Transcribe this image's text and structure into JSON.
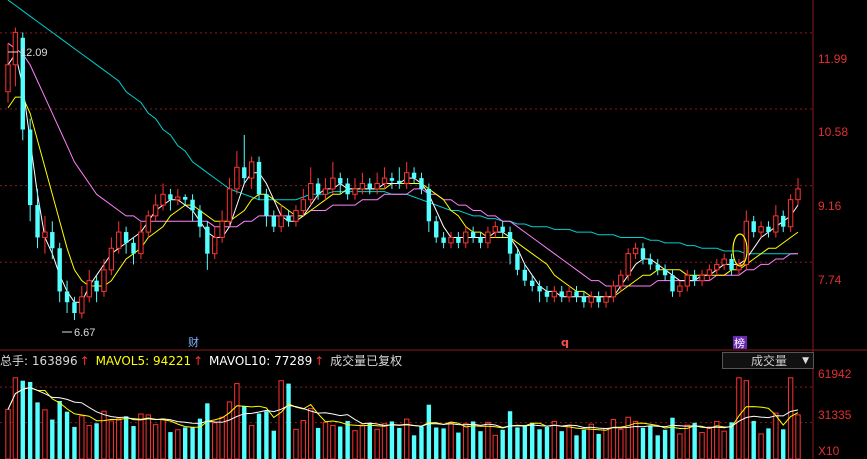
{
  "price_axis": {
    "ticks": [
      "11.99",
      "10.58",
      "9.16",
      "7.74"
    ]
  },
  "volume_axis": {
    "ticks": [
      "61942",
      "31335"
    ],
    "unit_label": "X10"
  },
  "annotations": {
    "high": "12.09",
    "low": "6.67",
    "event_a": "财",
    "event_b": "q",
    "event_c": "榜"
  },
  "volume_info": {
    "total_label": "总手: 163896",
    "ma5_label": "MAVOL5: 94221",
    "ma10_label": "MAVOL10: 77289",
    "arrow": "↑",
    "note": "成交量已复权"
  },
  "indicator_select": {
    "value": "成交量"
  },
  "colors": {
    "up": "#ff3232",
    "down": "#54ffff",
    "ma_white": "#ffffff",
    "ma_yellow": "#ffff00",
    "ma_magenta": "#ff80ff",
    "ma_cyan": "#00d0d0",
    "grid": "#8a1a1a"
  },
  "chart_data": {
    "type": "candlestick",
    "price_range": [
      6.3,
      12.6
    ],
    "price_ticks": [
      11.99,
      10.58,
      9.16,
      7.74
    ],
    "high_marker": 12.09,
    "low_marker": 6.67,
    "candles": [
      [
        10.9,
        11.4,
        11.8,
        10.7
      ],
      [
        11.4,
        12.0,
        12.09,
        11.0
      ],
      [
        11.9,
        10.2,
        12.0,
        10.0
      ],
      [
        10.2,
        8.8,
        10.4,
        8.5
      ],
      [
        8.8,
        8.2,
        9.1,
        8.0
      ],
      [
        8.2,
        8.3,
        8.6,
        7.9
      ],
      [
        8.3,
        8.0,
        8.5,
        7.8
      ],
      [
        8.0,
        7.2,
        8.1,
        7.0
      ],
      [
        7.2,
        7.0,
        7.4,
        6.8
      ],
      [
        7.0,
        6.8,
        7.1,
        6.67
      ],
      [
        6.8,
        7.1,
        7.3,
        6.7
      ],
      [
        7.1,
        7.4,
        7.6,
        7.0
      ],
      [
        7.4,
        7.2,
        7.5,
        7.0
      ],
      [
        7.2,
        7.6,
        7.8,
        7.1
      ],
      [
        7.6,
        8.0,
        8.2,
        7.5
      ],
      [
        8.0,
        8.3,
        8.5,
        7.9
      ],
      [
        8.3,
        8.1,
        8.4,
        7.9
      ],
      [
        8.1,
        7.9,
        8.2,
        7.7
      ],
      [
        7.9,
        8.3,
        8.5,
        7.8
      ],
      [
        8.3,
        8.6,
        8.7,
        8.2
      ],
      [
        8.6,
        8.8,
        9.0,
        8.5
      ],
      [
        8.8,
        9.0,
        9.2,
        8.7
      ],
      [
        9.0,
        8.9,
        9.1,
        8.7
      ],
      [
        8.9,
        8.95,
        9.1,
        8.8
      ],
      [
        8.95,
        8.9,
        9.0,
        8.8
      ],
      [
        8.9,
        8.7,
        9.0,
        8.5
      ],
      [
        8.7,
        8.4,
        8.8,
        8.2
      ],
      [
        8.4,
        7.9,
        8.5,
        7.6
      ],
      [
        7.9,
        8.2,
        8.4,
        7.8
      ],
      [
        8.2,
        8.5,
        8.7,
        8.1
      ],
      [
        8.5,
        9.1,
        9.3,
        8.4
      ],
      [
        9.1,
        9.5,
        9.8,
        9.0
      ],
      [
        9.5,
        9.3,
        10.1,
        9.2
      ],
      [
        9.3,
        9.6,
        9.7,
        9.1
      ],
      [
        9.6,
        9.0,
        9.7,
        8.9
      ],
      [
        9.0,
        8.6,
        9.1,
        8.4
      ],
      [
        8.6,
        8.4,
        8.7,
        8.3
      ],
      [
        8.4,
        8.6,
        8.8,
        8.3
      ],
      [
        8.6,
        8.5,
        8.7,
        8.4
      ],
      [
        8.5,
        8.7,
        8.8,
        8.4
      ],
      [
        8.7,
        8.9,
        9.1,
        8.6
      ],
      [
        8.9,
        9.2,
        9.5,
        8.8
      ],
      [
        9.2,
        9.0,
        9.3,
        8.9
      ],
      [
        9.0,
        9.1,
        9.3,
        8.9
      ],
      [
        9.1,
        9.3,
        9.6,
        9.0
      ],
      [
        9.3,
        9.2,
        9.4,
        9.0
      ],
      [
        9.2,
        9.0,
        9.3,
        8.9
      ],
      [
        9.0,
        9.1,
        9.3,
        8.9
      ],
      [
        9.1,
        9.2,
        9.4,
        9.0
      ],
      [
        9.2,
        9.1,
        9.3,
        9.0
      ],
      [
        9.1,
        9.2,
        9.4,
        9.0
      ],
      [
        9.2,
        9.3,
        9.5,
        9.1
      ],
      [
        9.3,
        9.25,
        9.4,
        9.1
      ],
      [
        9.25,
        9.2,
        9.5,
        9.1
      ],
      [
        9.2,
        9.4,
        9.6,
        9.1
      ],
      [
        9.4,
        9.3,
        9.5,
        9.2
      ],
      [
        9.3,
        9.1,
        9.4,
        9.0
      ],
      [
        9.1,
        8.5,
        9.2,
        8.3
      ],
      [
        8.5,
        8.2,
        8.6,
        8.1
      ],
      [
        8.2,
        8.1,
        8.3,
        8.0
      ],
      [
        8.1,
        8.2,
        8.3,
        8.0
      ],
      [
        8.2,
        8.1,
        8.3,
        8.0
      ],
      [
        8.1,
        8.3,
        8.4,
        8.0
      ],
      [
        8.3,
        8.2,
        8.4,
        8.1
      ],
      [
        8.2,
        8.1,
        8.3,
        8.0
      ],
      [
        8.1,
        8.3,
        8.4,
        8.0
      ],
      [
        8.3,
        8.4,
        8.5,
        8.2
      ],
      [
        8.4,
        8.3,
        8.5,
        8.2
      ],
      [
        8.3,
        7.9,
        8.4,
        7.7
      ],
      [
        7.9,
        7.6,
        8.0,
        7.5
      ],
      [
        7.6,
        7.4,
        7.7,
        7.3
      ],
      [
        7.4,
        7.3,
        7.5,
        7.2
      ],
      [
        7.3,
        7.2,
        7.4,
        7.0
      ],
      [
        7.2,
        7.1,
        7.3,
        7.0
      ],
      [
        7.1,
        7.2,
        7.3,
        7.0
      ],
      [
        7.2,
        7.1,
        7.3,
        7.0
      ],
      [
        7.1,
        7.2,
        7.3,
        7.0
      ],
      [
        7.2,
        7.1,
        7.3,
        7.0
      ],
      [
        7.1,
        7.0,
        7.2,
        6.9
      ],
      [
        7.0,
        7.1,
        7.2,
        6.9
      ],
      [
        7.1,
        7.0,
        7.2,
        6.9
      ],
      [
        7.0,
        7.1,
        7.2,
        6.9
      ],
      [
        7.1,
        7.3,
        7.4,
        7.0
      ],
      [
        7.3,
        7.5,
        7.6,
        7.2
      ],
      [
        7.5,
        7.9,
        8.0,
        7.4
      ],
      [
        7.9,
        8.0,
        8.1,
        7.8
      ],
      [
        8.0,
        7.8,
        8.1,
        7.7
      ],
      [
        7.8,
        7.7,
        7.9,
        7.6
      ],
      [
        7.7,
        7.6,
        7.8,
        7.5
      ],
      [
        7.6,
        7.5,
        7.7,
        7.4
      ],
      [
        7.5,
        7.2,
        7.6,
        7.1
      ],
      [
        7.2,
        7.3,
        7.4,
        7.1
      ],
      [
        7.3,
        7.5,
        7.6,
        7.2
      ],
      [
        7.5,
        7.4,
        7.6,
        7.3
      ],
      [
        7.4,
        7.5,
        7.6,
        7.3
      ],
      [
        7.5,
        7.6,
        7.7,
        7.4
      ],
      [
        7.6,
        7.7,
        7.8,
        7.5
      ],
      [
        7.7,
        7.8,
        7.9,
        7.6
      ],
      [
        7.8,
        7.6,
        7.9,
        7.5
      ],
      [
        7.6,
        7.7,
        7.8,
        7.5
      ],
      [
        7.7,
        8.5,
        8.7,
        7.6
      ],
      [
        8.5,
        8.3,
        8.6,
        8.2
      ],
      [
        8.3,
        8.4,
        8.5,
        8.2
      ],
      [
        8.4,
        8.3,
        8.5,
        8.2
      ],
      [
        8.3,
        8.6,
        8.8,
        8.2
      ],
      [
        8.6,
        8.4,
        8.7,
        8.3
      ],
      [
        8.4,
        8.9,
        9.0,
        8.3
      ],
      [
        8.9,
        9.1,
        9.3,
        8.8
      ]
    ],
    "ma_white": [
      11.4,
      11.6,
      11.0,
      10.0,
      9.0,
      8.2,
      7.9,
      7.5,
      7.2,
      7.0,
      7.0,
      7.3,
      7.5,
      7.7,
      7.9,
      8.0,
      8.1,
      8.2,
      8.3,
      8.5,
      8.7,
      8.8,
      8.9,
      8.9,
      8.8,
      8.7,
      8.5,
      8.3,
      8.2,
      8.2,
      8.4,
      8.8,
      9.2,
      9.4,
      9.4,
      9.2,
      8.9,
      8.6,
      8.5,
      8.5,
      8.6,
      8.8,
      9.0,
      9.1,
      9.1,
      9.2,
      9.1,
      9.1,
      9.1,
      9.1,
      9.1,
      9.2,
      9.2,
      9.2,
      9.3,
      9.3,
      9.2,
      9.0,
      8.7,
      8.4,
      8.2,
      8.2,
      8.2,
      8.2,
      8.2,
      8.2,
      8.3,
      8.3,
      8.2,
      8.0,
      7.7,
      7.5,
      7.3,
      7.2,
      7.2,
      7.1,
      7.1,
      7.1,
      7.1,
      7.1,
      7.1,
      7.1,
      7.1,
      7.3,
      7.5,
      7.7,
      7.8,
      7.8,
      7.7,
      7.6,
      7.5,
      7.4,
      7.4,
      7.4,
      7.5,
      7.5,
      7.6,
      7.7,
      7.7,
      7.7,
      7.8,
      8.0,
      8.2,
      8.3,
      8.4,
      8.5,
      8.6,
      8.8
    ],
    "ma_yellow": [
      10.6,
      10.8,
      10.8,
      10.5,
      10.0,
      9.5,
      9.0,
      8.5,
      8.0,
      7.6,
      7.4,
      7.3,
      7.3,
      7.3,
      7.4,
      7.6,
      7.8,
      7.9,
      8.0,
      8.2,
      8.3,
      8.4,
      8.6,
      8.7,
      8.8,
      8.8,
      8.7,
      8.6,
      8.5,
      8.5,
      8.5,
      8.6,
      8.7,
      8.9,
      9.0,
      9.0,
      8.9,
      8.8,
      8.7,
      8.6,
      8.6,
      8.7,
      8.8,
      8.9,
      9.0,
      9.0,
      9.1,
      9.1,
      9.1,
      9.1,
      9.1,
      9.1,
      9.2,
      9.2,
      9.2,
      9.2,
      9.2,
      9.1,
      9.0,
      8.9,
      8.7,
      8.6,
      8.4,
      8.3,
      8.3,
      8.2,
      8.2,
      8.2,
      8.2,
      8.1,
      8.0,
      7.9,
      7.8,
      7.7,
      7.5,
      7.4,
      7.3,
      7.2,
      7.2,
      7.1,
      7.1,
      7.1,
      7.1,
      7.2,
      7.3,
      7.4,
      7.5,
      7.5,
      7.6,
      7.6,
      7.6,
      7.6,
      7.5,
      7.5,
      7.5,
      7.5,
      7.5,
      7.5,
      7.6,
      7.6,
      7.7,
      7.8,
      7.9,
      8.0,
      8.0,
      8.1,
      8.2,
      8.3
    ],
    "ma_magenta": [
      11.8,
      11.7,
      11.6,
      11.4,
      11.1,
      10.8,
      10.5,
      10.2,
      9.9,
      9.6,
      9.4,
      9.2,
      9.0,
      8.9,
      8.8,
      8.7,
      8.6,
      8.6,
      8.5,
      8.5,
      8.5,
      8.5,
      8.5,
      8.5,
      8.5,
      8.5,
      8.5,
      8.5,
      8.4,
      8.4,
      8.4,
      8.4,
      8.5,
      8.5,
      8.6,
      8.6,
      8.6,
      8.6,
      8.6,
      8.6,
      8.6,
      8.7,
      8.7,
      8.7,
      8.8,
      8.8,
      8.8,
      8.8,
      8.9,
      8.9,
      8.9,
      9.0,
      9.0,
      9.0,
      9.0,
      9.1,
      9.1,
      9.0,
      9.0,
      8.9,
      8.9,
      8.8,
      8.8,
      8.7,
      8.7,
      8.6,
      8.6,
      8.5,
      8.5,
      8.4,
      8.3,
      8.2,
      8.1,
      8.0,
      7.9,
      7.8,
      7.7,
      7.6,
      7.5,
      7.4,
      7.4,
      7.3,
      7.3,
      7.3,
      7.3,
      7.3,
      7.3,
      7.3,
      7.4,
      7.4,
      7.4,
      7.4,
      7.4,
      7.4,
      7.4,
      7.4,
      7.5,
      7.5,
      7.5,
      7.5,
      7.6,
      7.6,
      7.7,
      7.7,
      7.8,
      7.8,
      7.9,
      7.9
    ],
    "ma_cyan": [
      12.6,
      12.5,
      12.4,
      12.3,
      12.2,
      12.1,
      12.0,
      11.9,
      11.8,
      11.7,
      11.6,
      11.5,
      11.4,
      11.3,
      11.2,
      11.1,
      10.9,
      10.8,
      10.7,
      10.5,
      10.4,
      10.2,
      10.1,
      9.9,
      9.8,
      9.6,
      9.5,
      9.4,
      9.3,
      9.2,
      9.1,
      9.05,
      9.0,
      8.95,
      8.9,
      8.9,
      8.9,
      8.9,
      8.9,
      8.9,
      8.95,
      9.0,
      9.0,
      9.0,
      9.05,
      9.05,
      9.05,
      9.05,
      9.05,
      9.05,
      9.05,
      9.05,
      9.0,
      9.0,
      9.0,
      8.95,
      8.9,
      8.85,
      8.8,
      8.75,
      8.7,
      8.7,
      8.65,
      8.6,
      8.6,
      8.55,
      8.55,
      8.5,
      8.5,
      8.45,
      8.45,
      8.4,
      8.4,
      8.4,
      8.35,
      8.35,
      8.35,
      8.3,
      8.3,
      8.3,
      8.25,
      8.25,
      8.25,
      8.2,
      8.2,
      8.2,
      8.2,
      8.15,
      8.15,
      8.1,
      8.1,
      8.1,
      8.05,
      8.05,
      8.0,
      8.0,
      8.0,
      7.95,
      7.95,
      7.95,
      7.9,
      7.9,
      7.9,
      7.9,
      7.9,
      7.9,
      7.9,
      7.9
    ],
    "volume_range": [
      0,
      75000
    ],
    "volume_ticks": [
      61942,
      31335
    ],
    "volume_events": [
      1,
      2,
      31,
      37,
      38,
      99,
      100,
      106
    ],
    "volume_base_seed": 1,
    "volume_mavol5": 94221,
    "volume_mavol10": 77289
  }
}
